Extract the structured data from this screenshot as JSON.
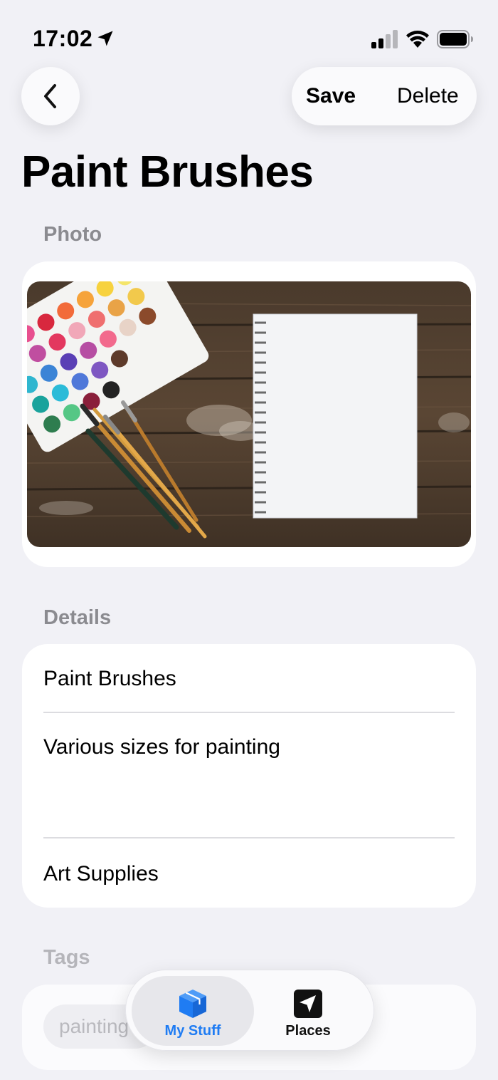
{
  "status_bar": {
    "time": "17:02"
  },
  "nav": {
    "save_label": "Save",
    "delete_label": "Delete"
  },
  "page": {
    "title": "Paint Brushes"
  },
  "sections": {
    "photo_label": "Photo",
    "details_label": "Details",
    "tags_label": "Tags"
  },
  "details": {
    "name": "Paint Brushes",
    "description": "Various sizes for painting",
    "category": "Art Supplies"
  },
  "tags": [
    "painting"
  ],
  "tab_bar": {
    "tabs": [
      {
        "label": "My Stuff",
        "icon": "cube-icon",
        "selected": true,
        "color": "#1f7cf3"
      },
      {
        "label": "Places",
        "icon": "location-arrow-icon",
        "selected": false,
        "color": "#111111"
      }
    ]
  },
  "colors": {
    "accent": "#1f7cf3",
    "background": "#f1f1f6",
    "secondary_text": "#8b8b90"
  }
}
